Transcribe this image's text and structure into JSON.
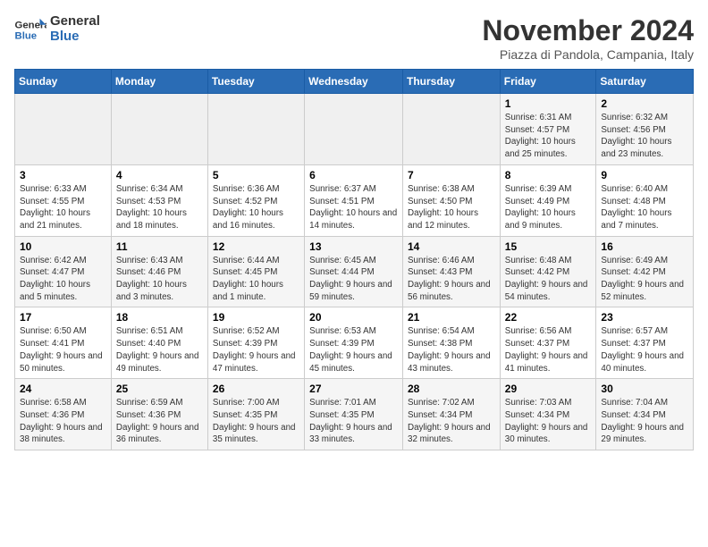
{
  "logo": {
    "line1": "General",
    "line2": "Blue"
  },
  "title": "November 2024",
  "subtitle": "Piazza di Pandola, Campania, Italy",
  "days_of_week": [
    "Sunday",
    "Monday",
    "Tuesday",
    "Wednesday",
    "Thursday",
    "Friday",
    "Saturday"
  ],
  "weeks": [
    [
      {
        "day": "",
        "info": ""
      },
      {
        "day": "",
        "info": ""
      },
      {
        "day": "",
        "info": ""
      },
      {
        "day": "",
        "info": ""
      },
      {
        "day": "",
        "info": ""
      },
      {
        "day": "1",
        "info": "Sunrise: 6:31 AM\nSunset: 4:57 PM\nDaylight: 10 hours and 25 minutes."
      },
      {
        "day": "2",
        "info": "Sunrise: 6:32 AM\nSunset: 4:56 PM\nDaylight: 10 hours and 23 minutes."
      }
    ],
    [
      {
        "day": "3",
        "info": "Sunrise: 6:33 AM\nSunset: 4:55 PM\nDaylight: 10 hours and 21 minutes."
      },
      {
        "day": "4",
        "info": "Sunrise: 6:34 AM\nSunset: 4:53 PM\nDaylight: 10 hours and 18 minutes."
      },
      {
        "day": "5",
        "info": "Sunrise: 6:36 AM\nSunset: 4:52 PM\nDaylight: 10 hours and 16 minutes."
      },
      {
        "day": "6",
        "info": "Sunrise: 6:37 AM\nSunset: 4:51 PM\nDaylight: 10 hours and 14 minutes."
      },
      {
        "day": "7",
        "info": "Sunrise: 6:38 AM\nSunset: 4:50 PM\nDaylight: 10 hours and 12 minutes."
      },
      {
        "day": "8",
        "info": "Sunrise: 6:39 AM\nSunset: 4:49 PM\nDaylight: 10 hours and 9 minutes."
      },
      {
        "day": "9",
        "info": "Sunrise: 6:40 AM\nSunset: 4:48 PM\nDaylight: 10 hours and 7 minutes."
      }
    ],
    [
      {
        "day": "10",
        "info": "Sunrise: 6:42 AM\nSunset: 4:47 PM\nDaylight: 10 hours and 5 minutes."
      },
      {
        "day": "11",
        "info": "Sunrise: 6:43 AM\nSunset: 4:46 PM\nDaylight: 10 hours and 3 minutes."
      },
      {
        "day": "12",
        "info": "Sunrise: 6:44 AM\nSunset: 4:45 PM\nDaylight: 10 hours and 1 minute."
      },
      {
        "day": "13",
        "info": "Sunrise: 6:45 AM\nSunset: 4:44 PM\nDaylight: 9 hours and 59 minutes."
      },
      {
        "day": "14",
        "info": "Sunrise: 6:46 AM\nSunset: 4:43 PM\nDaylight: 9 hours and 56 minutes."
      },
      {
        "day": "15",
        "info": "Sunrise: 6:48 AM\nSunset: 4:42 PM\nDaylight: 9 hours and 54 minutes."
      },
      {
        "day": "16",
        "info": "Sunrise: 6:49 AM\nSunset: 4:42 PM\nDaylight: 9 hours and 52 minutes."
      }
    ],
    [
      {
        "day": "17",
        "info": "Sunrise: 6:50 AM\nSunset: 4:41 PM\nDaylight: 9 hours and 50 minutes."
      },
      {
        "day": "18",
        "info": "Sunrise: 6:51 AM\nSunset: 4:40 PM\nDaylight: 9 hours and 49 minutes."
      },
      {
        "day": "19",
        "info": "Sunrise: 6:52 AM\nSunset: 4:39 PM\nDaylight: 9 hours and 47 minutes."
      },
      {
        "day": "20",
        "info": "Sunrise: 6:53 AM\nSunset: 4:39 PM\nDaylight: 9 hours and 45 minutes."
      },
      {
        "day": "21",
        "info": "Sunrise: 6:54 AM\nSunset: 4:38 PM\nDaylight: 9 hours and 43 minutes."
      },
      {
        "day": "22",
        "info": "Sunrise: 6:56 AM\nSunset: 4:37 PM\nDaylight: 9 hours and 41 minutes."
      },
      {
        "day": "23",
        "info": "Sunrise: 6:57 AM\nSunset: 4:37 PM\nDaylight: 9 hours and 40 minutes."
      }
    ],
    [
      {
        "day": "24",
        "info": "Sunrise: 6:58 AM\nSunset: 4:36 PM\nDaylight: 9 hours and 38 minutes."
      },
      {
        "day": "25",
        "info": "Sunrise: 6:59 AM\nSunset: 4:36 PM\nDaylight: 9 hours and 36 minutes."
      },
      {
        "day": "26",
        "info": "Sunrise: 7:00 AM\nSunset: 4:35 PM\nDaylight: 9 hours and 35 minutes."
      },
      {
        "day": "27",
        "info": "Sunrise: 7:01 AM\nSunset: 4:35 PM\nDaylight: 9 hours and 33 minutes."
      },
      {
        "day": "28",
        "info": "Sunrise: 7:02 AM\nSunset: 4:34 PM\nDaylight: 9 hours and 32 minutes."
      },
      {
        "day": "29",
        "info": "Sunrise: 7:03 AM\nSunset: 4:34 PM\nDaylight: 9 hours and 30 minutes."
      },
      {
        "day": "30",
        "info": "Sunrise: 7:04 AM\nSunset: 4:34 PM\nDaylight: 9 hours and 29 minutes."
      }
    ]
  ]
}
